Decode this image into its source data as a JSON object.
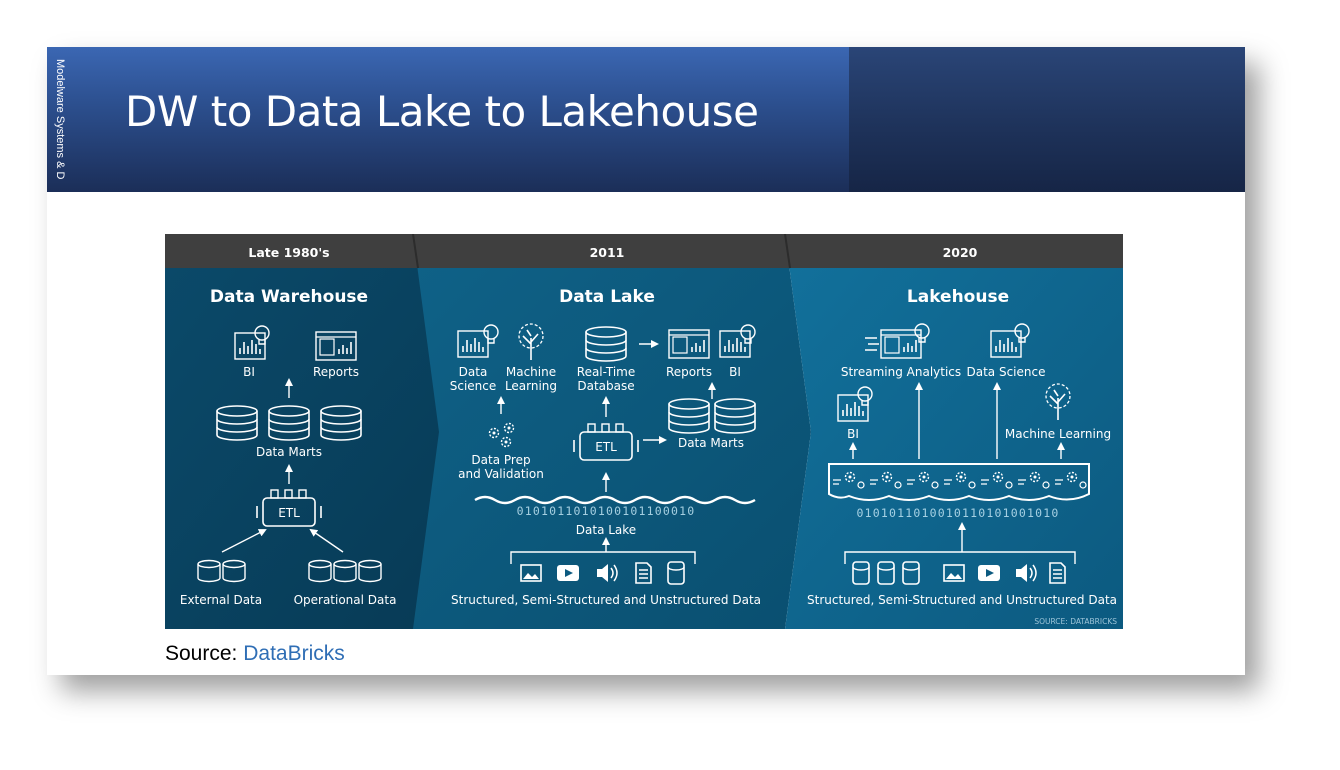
{
  "slide": {
    "title": "DW to Data Lake to Lakehouse",
    "side_text": "Modelware Systems & D",
    "source_label": "Source: ",
    "source_link": "DataBricks"
  },
  "colors": {
    "header_blue": "#2c4f8e",
    "panel_dark": "#0a4462",
    "panel_mid": "#0d5a80",
    "panel_light": "#11688f",
    "band": "#3f3f3f",
    "link": "#2f6eb5"
  },
  "diagram": {
    "eras": [
      {
        "year": "Late 1980's",
        "title": "Data Warehouse",
        "labels": {
          "bi": "BI",
          "reports": "Reports",
          "marts": "Data Marts",
          "etl": "ETL",
          "external": "External Data",
          "operational": "Operational Data"
        }
      },
      {
        "year": "2011",
        "title": "Data Lake",
        "labels": {
          "data_science_1": "Data",
          "data_science_2": "Science",
          "ml_1": "Machine",
          "ml_2": "Learning",
          "rtdb_1": "Real-Time",
          "rtdb_2": "Database",
          "reports": "Reports",
          "bi": "BI",
          "prep_1": "Data Prep",
          "prep_2": "and Validation",
          "etl": "ETL",
          "marts": "Data Marts",
          "binary": "0101011010100101100010",
          "lake": "Data Lake",
          "sources": "Structured, Semi-Structured and Unstructured Data"
        }
      },
      {
        "year": "2020",
        "title": "Lakehouse",
        "labels": {
          "streaming": "Streaming Analytics",
          "data_science": "Data Science",
          "bi": "BI",
          "ml": "Machine Learning",
          "binary": "0101011010010110101001010",
          "sources": "Structured, Semi-Structured and Unstructured Data",
          "credit": "SOURCE: DATABRICKS"
        }
      }
    ]
  }
}
